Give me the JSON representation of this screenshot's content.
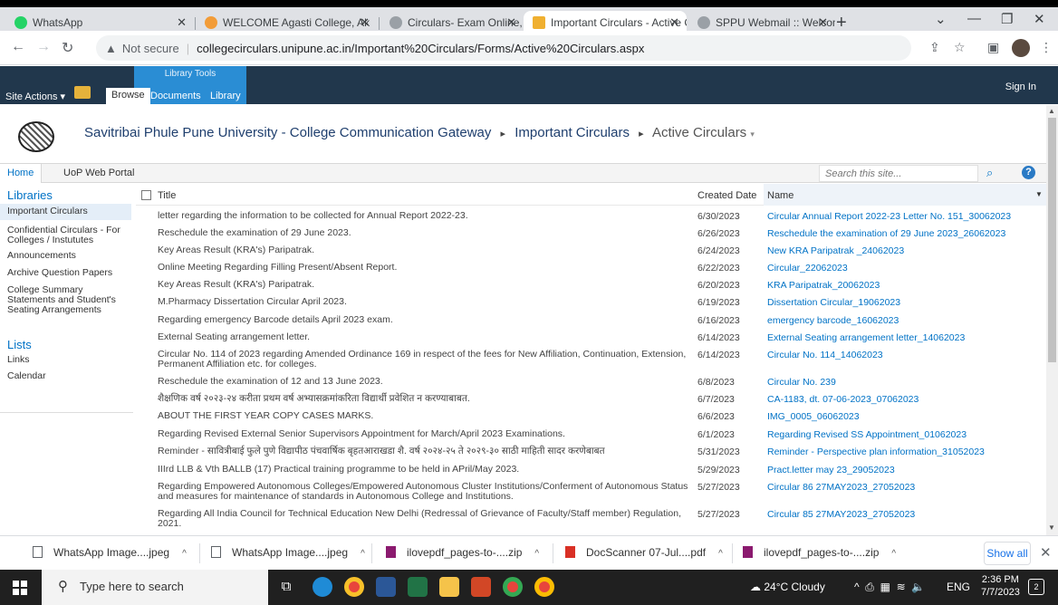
{
  "browser": {
    "tabs": [
      {
        "title": "WhatsApp",
        "favicon": "whatsapp-icon",
        "color": "#25d366"
      },
      {
        "title": "WELCOME Agasti College, Ak",
        "favicon": "college-icon",
        "color": "#f29c38"
      },
      {
        "title": "Circulars- Exam Online, Exam",
        "favicon": "university-icon",
        "color": "#9aa0a6"
      },
      {
        "title": "Important Circulars - Active C",
        "favicon": "sharepoint-icon",
        "color": "#f0b030"
      },
      {
        "title": "SPPU Webmail :: Welcome to",
        "favicon": "webmail-icon",
        "color": "#9aa0a6"
      }
    ],
    "security": "Not secure",
    "url": "collegecirculars.unipune.ac.in/Important%20Circulars/Forms/Active%20Circulars.aspx"
  },
  "ribbon": {
    "site_actions": "Site Actions",
    "browse": "Browse",
    "library_tools": "Library Tools",
    "documents": "Documents",
    "library": "Library",
    "sign_in": "Sign In"
  },
  "header": {
    "site": "Savitribai Phule Pune University - College Communication Gateway",
    "crumb1": "Important Circulars",
    "crumb2": "Active Circulars"
  },
  "topnav": {
    "home": "Home",
    "portal": "UoP Web Portal",
    "search_placeholder": "Search this site..."
  },
  "leftnav": {
    "libraries_heading": "Libraries",
    "libraries": [
      "Important Circulars",
      "Confidential Circulars - For Colleges / Instututes",
      "Announcements",
      "Archive Question Papers",
      "College Summary Statements and Student's Seating Arrangements"
    ],
    "lists_heading": "Lists",
    "lists": [
      "Links",
      "Calendar"
    ]
  },
  "list": {
    "col_title": "Title",
    "col_date": "Created Date",
    "col_name": "Name",
    "rows": [
      {
        "title": "letter regarding the information to be collected for Annual Report 2022-23.",
        "date": "6/30/2023",
        "name": "Circular Annual Report 2022-23 Letter No. 151_30062023"
      },
      {
        "title": "Reschedule the examination of 29 June 2023.",
        "date": "6/26/2023",
        "name": "Reschedule the examination of 29 June 2023_26062023"
      },
      {
        "title": "Key Areas Result (KRA's) Paripatrak.",
        "date": "6/24/2023",
        "name": "New KRA Paripatrak _24062023"
      },
      {
        "title": "Online Meeting Regarding Filling Present/Absent Report.",
        "date": "6/22/2023",
        "name": "Circular_22062023"
      },
      {
        "title": "Key Areas Result (KRA's) Paripatrak.",
        "date": "6/20/2023",
        "name": "KRA Paripatrak_20062023"
      },
      {
        "title": "M.Pharmacy Dissertation Circular April 2023.",
        "date": "6/19/2023",
        "name": "Dissertation Circular_19062023"
      },
      {
        "title": "Regarding emergency Barcode details April 2023 exam.",
        "date": "6/16/2023",
        "name": "emergency barcode_16062023"
      },
      {
        "title": "External Seating arrangement letter.",
        "date": "6/14/2023",
        "name": "External Seating arrangement letter_14062023"
      },
      {
        "title": "Circular No. 114 of 2023 regarding Amended Ordinance 169 in respect of the fees for New Affiliation, Continuation, Extension, Permanent Affiliation etc. for colleges.",
        "date": "6/14/2023",
        "name": "Circular No. 114_14062023"
      },
      {
        "title": "Reschedule the examination of 12 and 13 June 2023.",
        "date": "6/8/2023",
        "name": "Circular No. 239"
      },
      {
        "title": "शैक्षणिक वर्ष २०२३-२४ करीता प्रथम वर्ष अभ्यासक्रमांकरिता विद्यार्थी प्रवेशित न करण्याबाबत.",
        "date": "6/7/2023",
        "name": "CA-1183, dt. 07-06-2023_07062023"
      },
      {
        "title": "ABOUT THE FIRST YEAR COPY CASES MARKS.",
        "date": "6/6/2023",
        "name": "IMG_0005_06062023"
      },
      {
        "title": "Regarding Revised External Senior Supervisors Appointment for March/April 2023 Examinations.",
        "date": "6/1/2023",
        "name": "Regarding Revised SS Appointment_01062023"
      },
      {
        "title": "Reminder - सावित्रीबाई फुले पुणे विद्यापीठ पंचवार्षिक बृहतआराखडा  शै. वर्ष २०२४-२५ ते २०२९-३० साठी माहिती सादर करणेबाबत",
        "date": "5/31/2023",
        "name": "Reminder - Perspective plan information_31052023"
      },
      {
        "title": "IIIrd LLB & Vth BALLB (17) Practical training programme to be held in APril/May 2023.",
        "date": "5/29/2023",
        "name": "Pract.letter may 23_29052023"
      },
      {
        "title": "Regarding Empowered Autonomous Colleges/Empowered Autonomous Cluster Institutions/Conferment of Autonomous Status and measures for maintenance of standards in Autonomous College and Institutions.",
        "date": "5/27/2023",
        "name": "Circular 86 27MAY2023_27052023"
      },
      {
        "title": "Regarding All India Council for Technical Education New Delhi (Redressal of Grievance of Faculty/Staff member) Regulation, 2021.",
        "date": "5/27/2023",
        "name": "Circular 85 27MAY2023_27052023"
      }
    ]
  },
  "downloads": {
    "items": [
      {
        "name": "WhatsApp Image....jpeg",
        "icon": "image-file-icon",
        "color": "#5f6368"
      },
      {
        "name": "WhatsApp Image....jpeg",
        "icon": "image-file-icon",
        "color": "#5f6368"
      },
      {
        "name": "ilovepdf_pages-to-....zip",
        "icon": "archive-icon",
        "color": "#8b1a6f"
      },
      {
        "name": "DocScanner 07-Jul....pdf",
        "icon": "pdf-icon",
        "color": "#d93025"
      },
      {
        "name": "ilovepdf_pages-to-....zip",
        "icon": "archive-icon",
        "color": "#8b1a6f"
      }
    ],
    "show_all": "Show all"
  },
  "taskbar": {
    "search_placeholder": "Type here to search",
    "weather": "24°C  Cloudy",
    "lang": "ENG",
    "time": "2:36 PM",
    "date": "7/7/2023",
    "notifications": "2"
  }
}
